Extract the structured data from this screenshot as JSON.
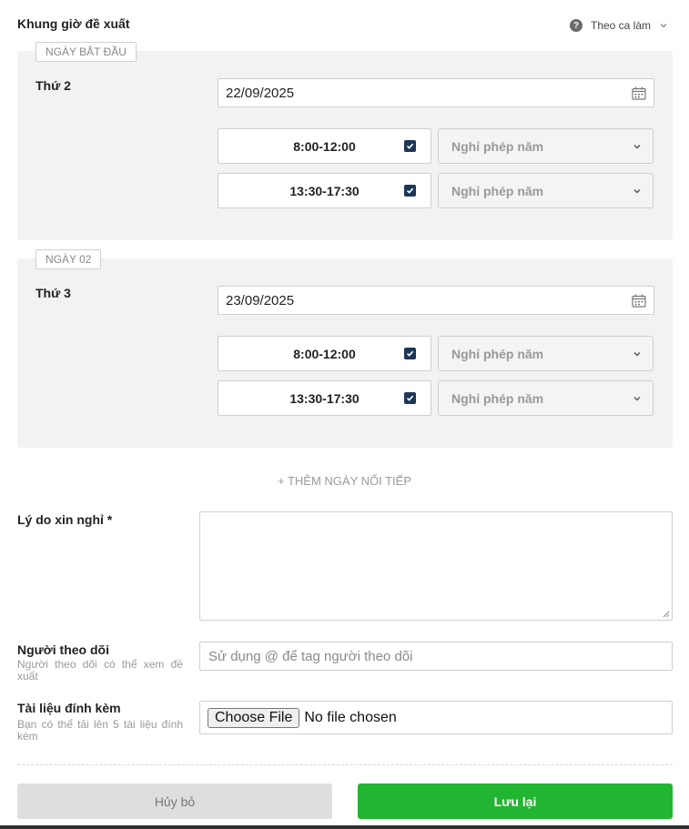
{
  "header": {
    "title": "Khung giờ đề xuất",
    "mode_label": "Theo ca làm",
    "help_glyph": "?"
  },
  "days": [
    {
      "tag": "NGÀY BẮT ĐẦU",
      "weekday": "Thứ 2",
      "date": "22/09/2025",
      "slots": [
        {
          "time": "8:00-12:00",
          "checked": true,
          "leave_type": "Nghỉ phép năm"
        },
        {
          "time": "13:30-17:30",
          "checked": true,
          "leave_type": "Nghỉ phép năm"
        }
      ]
    },
    {
      "tag": "NGÀY 02",
      "weekday": "Thứ 3",
      "date": "23/09/2025",
      "slots": [
        {
          "time": "8:00-12:00",
          "checked": true,
          "leave_type": "Nghỉ phép năm"
        },
        {
          "time": "13:30-17:30",
          "checked": true,
          "leave_type": "Nghỉ phép năm"
        }
      ]
    }
  ],
  "add_day_label": "+ THÊM NGÀY NỐI TIẾP",
  "reason": {
    "label": "Lý do xin nghỉ *",
    "value": ""
  },
  "followers": {
    "label": "Người theo dõi",
    "hint": "Người theo dõi có thể xem đề xuất",
    "placeholder": "Sử dụng @ để tag người theo dõi"
  },
  "attachments": {
    "label": "Tài liệu đính kèm",
    "hint": "Bạn có thể tải lên 5 tài liệu đính kèm",
    "button_label": "Choose File",
    "status": "No file chosen"
  },
  "actions": {
    "cancel_label": "Hủy bỏ",
    "save_label": "Lưu lại"
  },
  "colors": {
    "save_green": "#21b532",
    "checkbox_navy": "#1c3757",
    "panel_gray": "#f2f2f2"
  }
}
